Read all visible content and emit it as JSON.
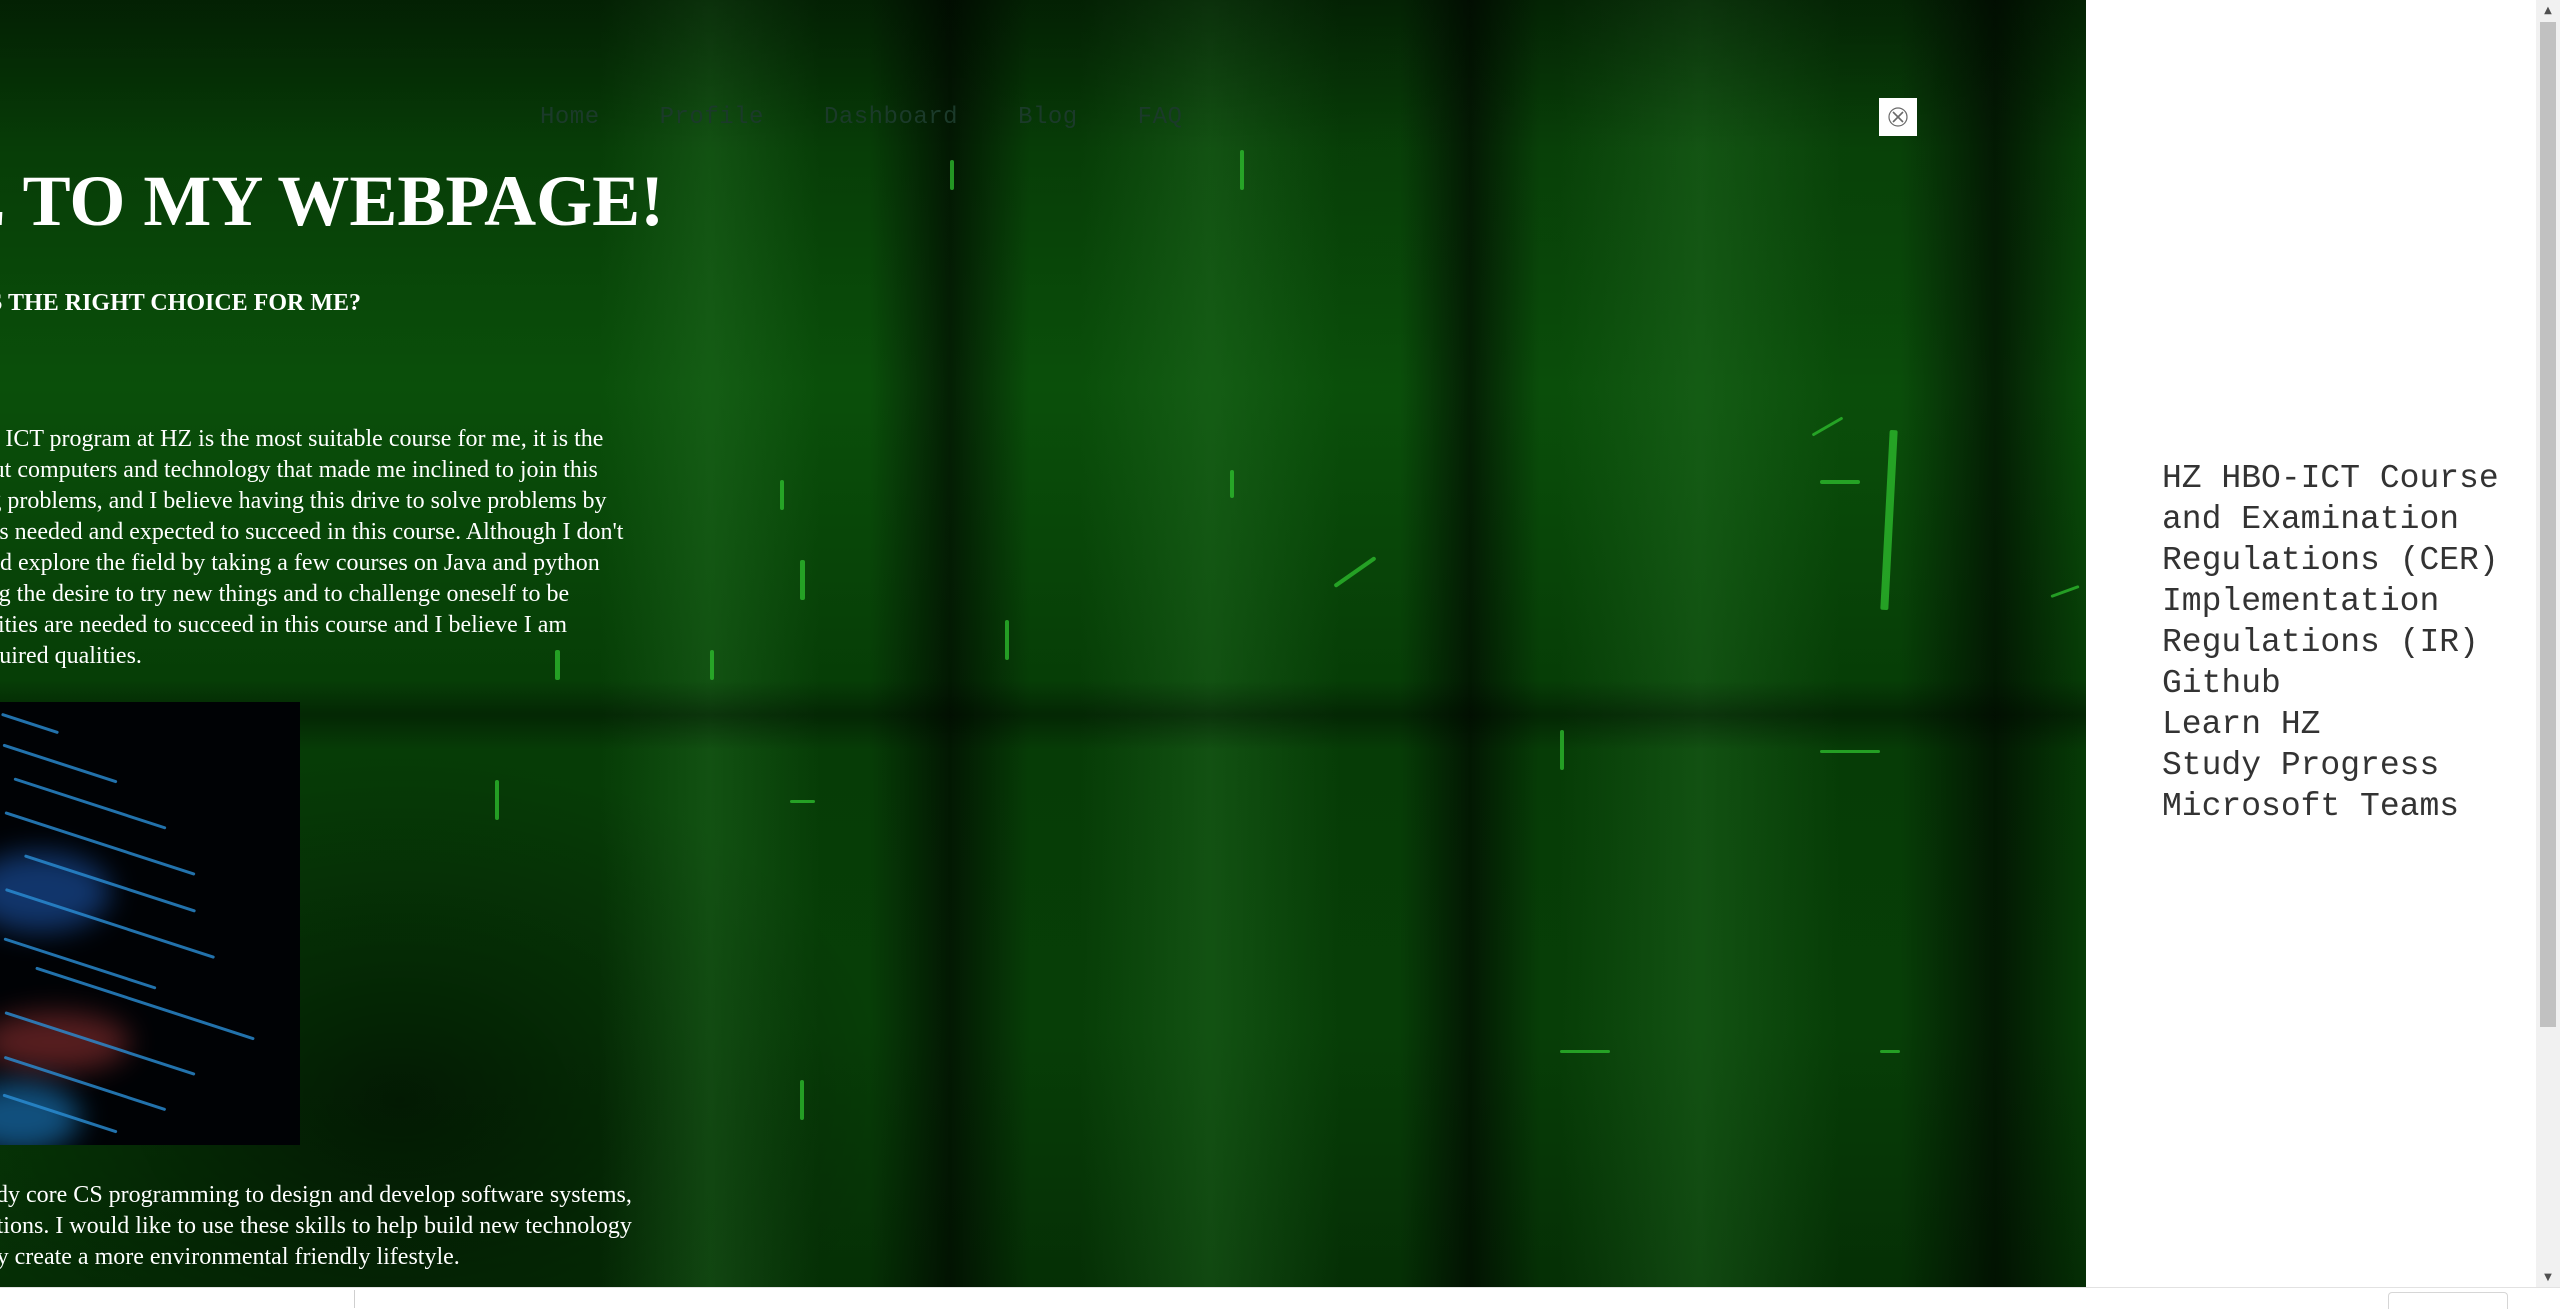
{
  "nav": {
    "items": [
      "Home",
      "Profile",
      "Dashboard",
      "Blog",
      "FAQ"
    ]
  },
  "header": {
    "title": "ME TO MY WEBPAGE!",
    "subtitle": "RAM AT HZ IS THE RIGHT CHOICE FOR ME?"
  },
  "content": {
    "paragraph1": [
      "hy the ICT program at HZ is the most suitable course for me, it is the",
      "g about computers and technology that made me inclined to join this",
      "olving problems, and I believe having this drive to solve problems by",
      "what is needed and expected to succeed in this course. Although I don't",
      "ce I did explore the field by taking a few courses on Java and python",
      "Having the desire to try new things and to challenge oneself to be",
      "e qualities are needed to succeed in this course and I believe I am",
      "he required qualities."
    ],
    "paragraph2": [
      "o study core CS programming to design and develop software systems,",
      "plications. I would like to use these skills to help build new technology",
      "ociety create a more environmental friendly lifestyle."
    ]
  },
  "sidebar": {
    "links": [
      "HZ HBO-ICT Course",
      "and Examination",
      "Regulations (CER)",
      "Implementation",
      "Regulations (IR)",
      "Github",
      "Learn HZ",
      "Study Progress",
      "Microsoft Teams"
    ]
  },
  "icons": {
    "close": "close-icon",
    "scroll_up": "arrow-up-icon",
    "scroll_down": "arrow-down-icon"
  },
  "colors": {
    "background_green": "#0a4f0a",
    "text": "#ffffff",
    "nav_text": "#1b3a2a",
    "sidebar_text": "#333333"
  }
}
